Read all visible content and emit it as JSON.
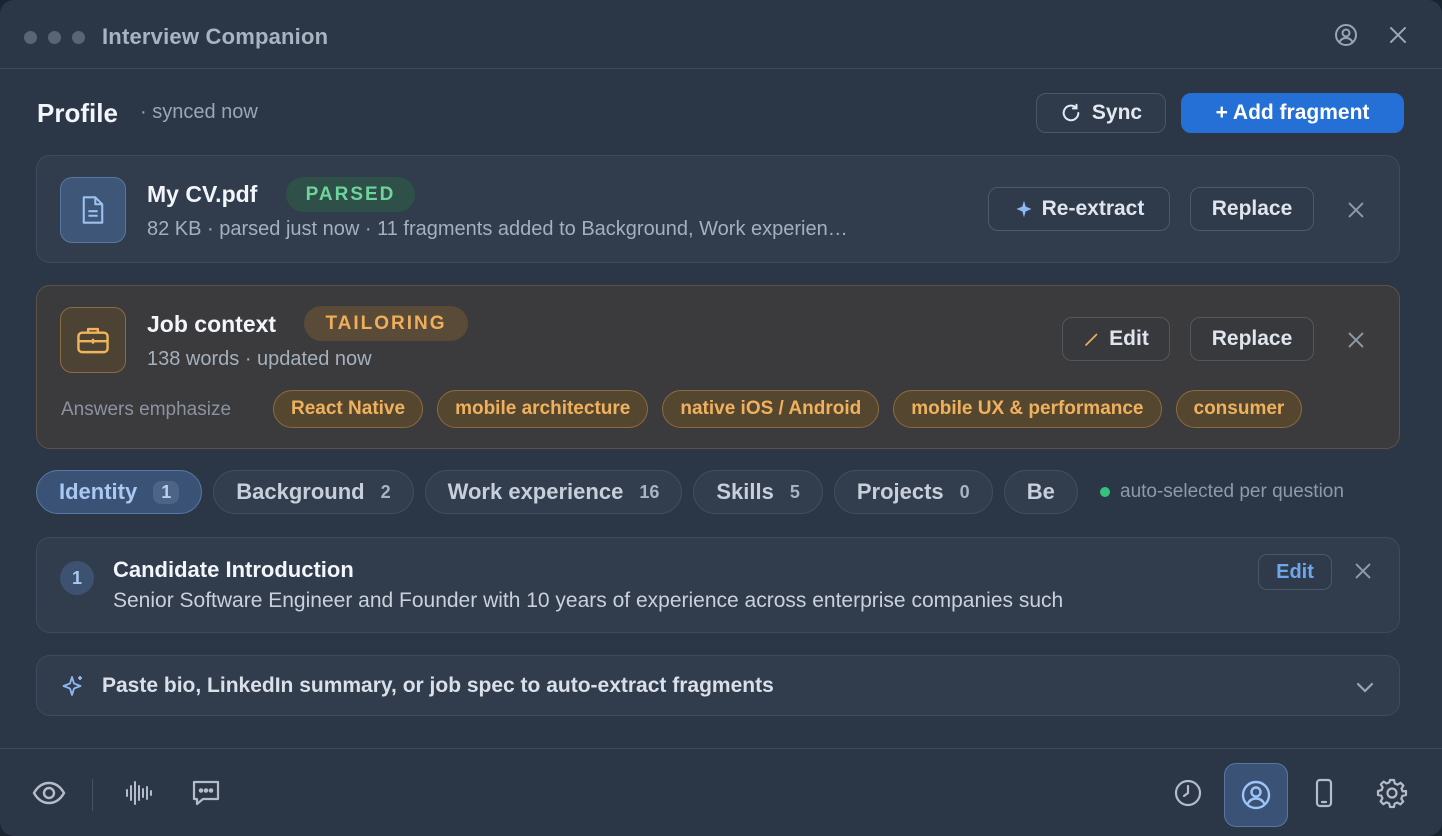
{
  "window": {
    "title": "Interview Companion"
  },
  "header": {
    "title": "Profile",
    "status": "· synced now",
    "sync_label": "Sync",
    "add_label": "+ Add fragment"
  },
  "cv_card": {
    "title": "My CV.pdf",
    "badge": "PARSED",
    "subtitle": "82 KB · parsed just now · 11 fragments added to Background, Work experien…",
    "reextract_label": "Re-extract",
    "replace_label": "Replace"
  },
  "job_card": {
    "title": "Job context",
    "badge": "TAILORING",
    "subtitle": "138 words · updated now",
    "edit_label": "Edit",
    "replace_label": "Replace",
    "emphasize_label": "Answers emphasize",
    "chips": [
      "React Native",
      "mobile architecture",
      "native iOS / Android",
      "mobile UX & performance",
      "consumer"
    ]
  },
  "tabs": [
    {
      "label": "Identity",
      "count": "1",
      "active": true
    },
    {
      "label": "Background",
      "count": "2",
      "active": false
    },
    {
      "label": "Work experience",
      "count": "16",
      "active": false
    },
    {
      "label": "Skills",
      "count": "5",
      "active": false
    },
    {
      "label": "Projects",
      "count": "0",
      "active": false
    },
    {
      "label": "Be",
      "count": "",
      "active": false
    }
  ],
  "auto_selected": "auto-selected per question",
  "fragment": {
    "number": "1",
    "title": "Candidate Introduction",
    "text": "Senior Software Engineer and Founder with 10 years of experience across enterprise companies such",
    "edit_label": "Edit"
  },
  "paste": {
    "label": "Paste bio, LinkedIn summary, or job spec to auto-extract fragments"
  },
  "colors": {
    "accent": "#2570d6",
    "parsed": "#6fd49c",
    "tailoring": "#efae5a",
    "window_bg": "#2b3646"
  },
  "icons": {
    "cv": "document-icon",
    "job": "briefcase-icon",
    "footer_left": [
      "eye-icon",
      "waveform-icon",
      "chat-icon"
    ],
    "footer_right": [
      "history-icon",
      "profile-icon",
      "phone-icon",
      "gear-icon"
    ]
  }
}
